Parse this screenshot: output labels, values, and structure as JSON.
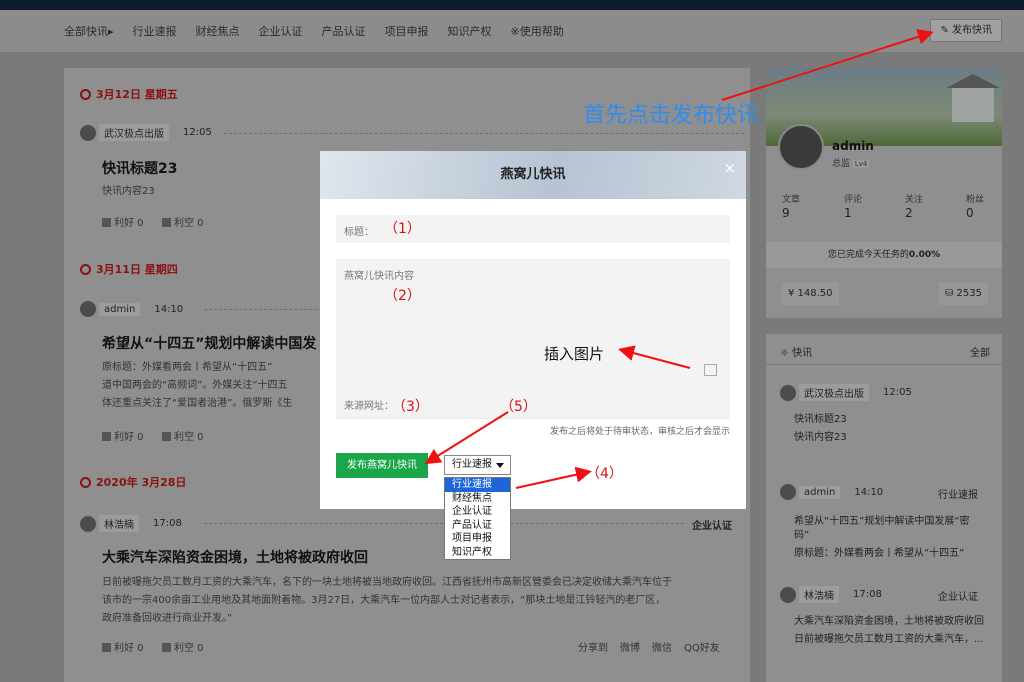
{
  "nav": {
    "items": [
      "全部快讯▸",
      "行业速报",
      "财经焦点",
      "企业认证",
      "产品认证",
      "项目申报",
      "知识产权",
      "※使用帮助"
    ],
    "publish_label": "✎ 发布快讯"
  },
  "feed": {
    "date1": "3月12日 星期五",
    "date2": "3月11日 星期四",
    "date3": "2020年 3月28日",
    "posts": [
      {
        "author": "武汉极点出版",
        "time": "12:05",
        "title": "快讯标题23",
        "content": "快讯内容23",
        "like": "利好 0",
        "dislike": "利空 0"
      },
      {
        "author": "admin",
        "time": "14:10",
        "title": "希望从“十四五”规划中解读中国发",
        "content1": "原标题：外媒看两会丨希望从“十四五”",
        "content2": "道中国两会的“高频词”。外媒关注“十四五",
        "content3": "体还重点关注了“爱国者治港”。俄罗斯《生",
        "like": "利好 0",
        "dislike": "利空 0"
      },
      {
        "author": "林浩楠",
        "time": "17:08",
        "category": "企业认证",
        "title": "大乘汽车深陷资金困境，土地将被政府收回",
        "content1": "日前被曝拖欠员工数月工资的大乘汽车，名下的一块土地将被当地政府收回。江西省抚州市高新区管委会已决定收储大乘汽车位于",
        "content2": "该市的一宗400余亩工业用地及其地面附着物。3月27日，大乘汽车一位内部人士对记者表示，“那块土地是江铃轻汽的老厂区，",
        "content3": "政府准备回收进行商业开发。”",
        "like": "利好 0",
        "dislike": "利空 0",
        "share": [
          "分享到",
          "微博",
          "微信",
          "QQ好友"
        ]
      }
    ]
  },
  "profile": {
    "name": "admin",
    "role": "总监",
    "role_badge": "Lv4",
    "stats": [
      {
        "label": "文章",
        "value": "9"
      },
      {
        "label": "评论",
        "value": "1"
      },
      {
        "label": "关注",
        "value": "2"
      },
      {
        "label": "粉丝",
        "value": "0"
      }
    ],
    "task_text": "您已完成今天任务的",
    "task_pct": "0.00%",
    "money": "¥ 148.50",
    "credits": "⛁ 2535"
  },
  "side_flash": {
    "title": "快讯",
    "all": "全部",
    "items": [
      {
        "author": "武汉极点出版",
        "time": "12:05",
        "line1": "快讯标题23",
        "line2": "快讯内容23"
      },
      {
        "author": "admin",
        "time": "14:10",
        "category": "行业速报",
        "line1": "希望从“十四五”规划中解读中国发展“密",
        "line1b": "码”",
        "line2": "原标题：外媒看两会丨希望从“十四五”"
      },
      {
        "author": "林浩楠",
        "time": "17:08",
        "category": "企业认证",
        "line1": "大乘汽车深陷资金困境，土地将被政府收回",
        "line2": "日前被曝拖欠员工数月工资的大乘汽车，..."
      }
    ]
  },
  "modal": {
    "title": "燕窝儿快讯",
    "close": "×",
    "title_label": "标题：",
    "content_placeholder": "燕窝儿快讯内容",
    "url_label": "来源网址：",
    "note": "发布之后将处于待审状态，审核之后才会显示",
    "submit": "发布燕窝儿快讯",
    "select_value": "行业速报",
    "options": [
      "行业速报",
      "财经焦点",
      "企业认证",
      "产品认证",
      "项目申报",
      "知识产权"
    ]
  },
  "annotations": {
    "instruction": "首先点击发布快讯",
    "insert_image": "插入图片",
    "n1": "（1）",
    "n2": "（2）",
    "n3": "（3）",
    "n4": "（4）",
    "n5": "（5）"
  }
}
